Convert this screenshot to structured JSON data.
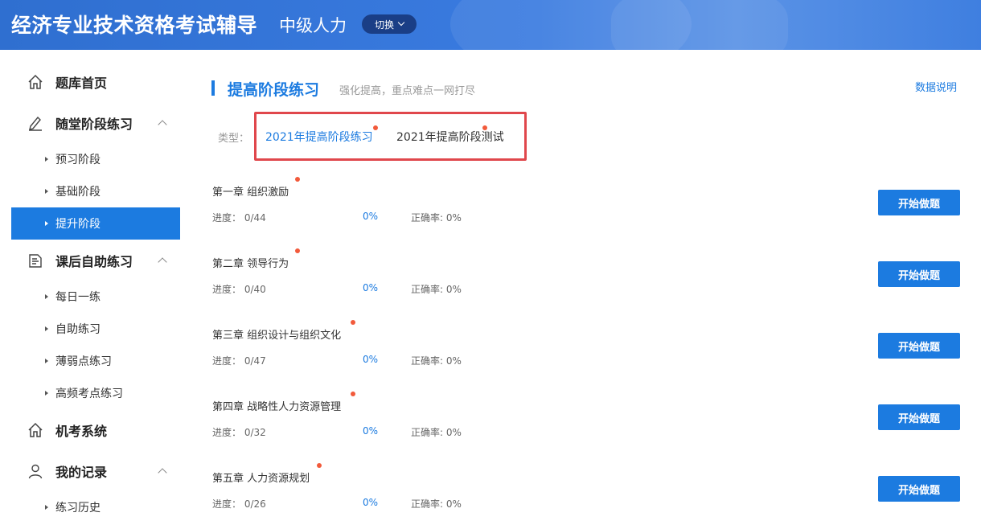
{
  "header": {
    "title": "经济专业技术资格考试辅导",
    "subtitle": "中级人力",
    "switch_label": "切换"
  },
  "sidebar": {
    "items": [
      {
        "label": "题库首页",
        "type": "main",
        "icon": "home-icon"
      },
      {
        "label": "随堂阶段练习",
        "type": "main",
        "icon": "pen-icon",
        "expanded": true
      },
      {
        "label": "预习阶段",
        "type": "sub"
      },
      {
        "label": "基础阶段",
        "type": "sub"
      },
      {
        "label": "提升阶段",
        "type": "sub",
        "active": true
      },
      {
        "label": "课后自助练习",
        "type": "main",
        "icon": "notes-icon",
        "expanded": true
      },
      {
        "label": "每日一练",
        "type": "sub"
      },
      {
        "label": "自助练习",
        "type": "sub"
      },
      {
        "label": "薄弱点练习",
        "type": "sub"
      },
      {
        "label": "高频考点练习",
        "type": "sub"
      },
      {
        "label": "机考系统",
        "type": "main",
        "icon": "home-icon"
      },
      {
        "label": "我的记录",
        "type": "main",
        "icon": "user-icon",
        "expanded": true
      },
      {
        "label": "练习历史",
        "type": "sub"
      }
    ]
  },
  "main": {
    "title": "提高阶段练习",
    "description": "强化提高，重点难点一网打尽",
    "data_link": "数据说明",
    "type_label": "类型：",
    "type_tabs": [
      {
        "label": "2021年提高阶段练习",
        "active": true
      },
      {
        "label": "2021年提高阶段测试",
        "active": false
      }
    ],
    "chapters": [
      {
        "title": "第一章 组织激励",
        "progress": "进度： 0/44",
        "percent": "0%",
        "accuracy": "正确率: 0%",
        "button": "开始做题"
      },
      {
        "title": "第二章 领导行为",
        "progress": "进度： 0/40",
        "percent": "0%",
        "accuracy": "正确率: 0%",
        "button": "开始做题"
      },
      {
        "title": "第三章 组织设计与组织文化",
        "progress": "进度： 0/47",
        "percent": "0%",
        "accuracy": "正确率: 0%",
        "button": "开始做题"
      },
      {
        "title": "第四章 战略性人力资源管理",
        "progress": "进度： 0/32",
        "percent": "0%",
        "accuracy": "正确率: 0%",
        "button": "开始做题"
      },
      {
        "title": "第五章 人力资源规划",
        "progress": "进度： 0/26",
        "percent": "0%",
        "accuracy": "正确率: 0%",
        "button": "开始做题"
      }
    ]
  },
  "colors": {
    "accent": "#1c7be0",
    "header": "#2f6fd0",
    "highlight_border": "#e0474c",
    "dot": "#f25a3b"
  }
}
